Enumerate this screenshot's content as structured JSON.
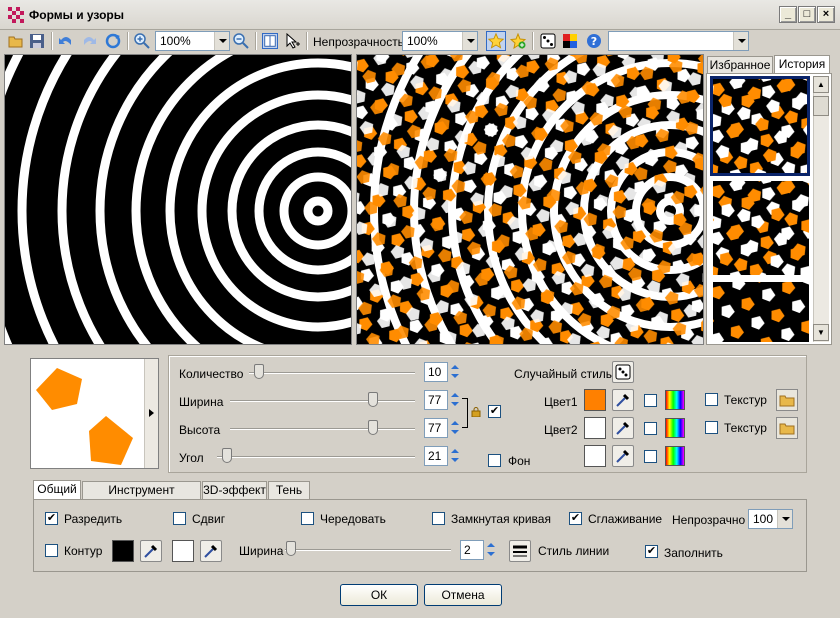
{
  "window": {
    "title": "Формы и узоры"
  },
  "toolbar": {
    "zoom_value": "100%",
    "opacity_label": "Непрозрачность",
    "opacity_value": "100%",
    "extra_combo_value": ""
  },
  "side_panel": {
    "tabs": [
      {
        "label": "Избранное"
      },
      {
        "label": "История"
      }
    ],
    "active_tab": "История"
  },
  "params": {
    "count_label": "Количество",
    "count_value": "10",
    "width_label": "Ширина",
    "width_value": "77",
    "height_label": "Высота",
    "height_value": "77",
    "angle_label": "Угол",
    "angle_value": "21",
    "random_style_label": "Случайный стиль",
    "color1_label": "Цвет1",
    "color2_label": "Цвет2",
    "texture1_label": "Текстур",
    "texture2_label": "Текстур",
    "background_label": "Фон"
  },
  "colors": {
    "color1": "#ff8000",
    "color2": "#ffffff",
    "bg_color": "#ffffff",
    "outline_color": "#000000",
    "outline_color2": "#ffffff"
  },
  "tabs": [
    {
      "label": "Общий"
    },
    {
      "label": "Инструмент Обводка"
    },
    {
      "label": "3D-эффект"
    },
    {
      "label": "Тень"
    }
  ],
  "general": {
    "sparse_label": "Разредить",
    "sparse_checked": true,
    "shift_label": "Сдвиг",
    "shift_checked": false,
    "alternate_label": "Чередовать",
    "alternate_checked": false,
    "closed_curve_label": "Замкнутая кривая",
    "closed_curve_checked": false,
    "smoothing_label": "Сглаживание",
    "smoothing_checked": true,
    "opaque_label": "Непрозрачно",
    "opaque_value": "100",
    "contour_label": "Контур",
    "contour_checked": false,
    "width_label": "Ширина",
    "width_value": "2",
    "line_style_label": "Стиль линии",
    "fill_label": "Заполнить",
    "fill_checked": true
  },
  "buttons": {
    "ok": "ОК",
    "cancel": "Отмена"
  }
}
